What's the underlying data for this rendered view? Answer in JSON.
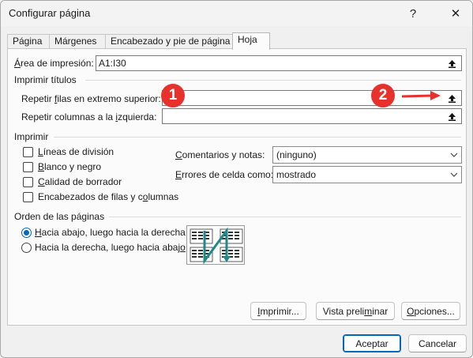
{
  "window": {
    "title": "Configurar página",
    "help_label": "?",
    "close_label": "✕"
  },
  "tabs": [
    {
      "label": "Página"
    },
    {
      "label": "Márgenes"
    },
    {
      "label": "Encabezado y pie de página"
    },
    {
      "label": "Hoja",
      "active": true
    }
  ],
  "print_area": {
    "label_pre": "Á",
    "label_rest": "rea de impresión:",
    "value": "A1:I30"
  },
  "print_titles": {
    "heading": "Imprimir títulos",
    "rows_label_pre": "Repetir ",
    "rows_label_u": "f",
    "rows_label_post": "ilas en extremo superior:",
    "rows_value": "",
    "cols_label_pre": "Repetir columnas a la ",
    "cols_label_u": "i",
    "cols_label_post": "zquierda:",
    "cols_value": ""
  },
  "print": {
    "heading": "Imprimir",
    "checkboxes": [
      {
        "u": "L",
        "rest": "íneas de división",
        "checked": false
      },
      {
        "u": "B",
        "rest": "lanco y negro",
        "checked": false
      },
      {
        "u": "C",
        "rest": "alidad de borrador",
        "checked": false
      },
      {
        "pre": "Encabezados de filas y c",
        "u": "o",
        "rest": "lumnas",
        "checked": false
      }
    ],
    "comments_label_u": "C",
    "comments_label_rest": "omentarios y notas:",
    "comments_value": "(ninguno)",
    "errors_label_u": "E",
    "errors_label_rest": "rrores de celda como:",
    "errors_value": "mostrado"
  },
  "page_order": {
    "heading": "Orden de las páginas",
    "options": [
      {
        "u": "H",
        "rest": "acia abajo, luego hacia la derecha",
        "selected": true
      },
      {
        "pre": "Hacia la derecha, luego hacia abaj",
        "u": "o",
        "rest": "",
        "selected": false
      }
    ]
  },
  "buttons": {
    "print_u": "I",
    "print_rest": "mprimir...",
    "preview_pre": "Vista preli",
    "preview_u": "m",
    "preview_rest": "inar",
    "options_u": "O",
    "options_rest": "pciones...",
    "accept": "Aceptar",
    "cancel": "Cancelar"
  },
  "annotations": {
    "badge1": "1",
    "badge2": "2",
    "badge_color": "#e8312c"
  },
  "colors": {
    "accent": "#0067c0",
    "order_arrow": "#1f8a8a"
  }
}
